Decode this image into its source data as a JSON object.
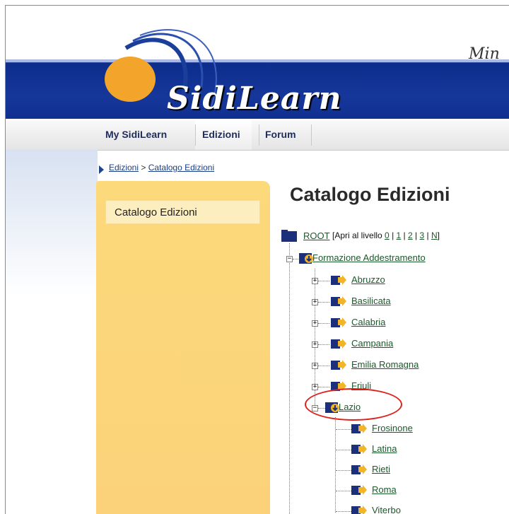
{
  "header": {
    "logo_text": "SidiLearn",
    "ministry_text": "Min"
  },
  "nav": {
    "items": [
      "My SidiLearn",
      "Edizioni",
      "Forum"
    ]
  },
  "breadcrumb": {
    "items": [
      "Edizioni",
      "Catalogo Edizioni"
    ],
    "separator": ">"
  },
  "sidebar": {
    "items": [
      "Catalogo Edizioni"
    ]
  },
  "main": {
    "title": "Catalogo Edizioni",
    "tree": {
      "root_label": "ROOT",
      "open_level_prefix": "[Apri al livello",
      "levels": [
        "0",
        "1",
        "2",
        "3",
        "N"
      ],
      "level_suffix": "]",
      "group_label": "Formazione Addestramento",
      "regions": [
        "Abruzzo",
        "Basilicata",
        "Calabria",
        "Campania",
        "Emilia Romagna",
        "Friuli",
        "Lazio"
      ],
      "lazio_children": [
        "Frosinone",
        "Latina",
        "Rieti",
        "Roma",
        "Viterbo"
      ]
    }
  },
  "colors": {
    "banner_blue": "#16379a",
    "sidebar_yellow": "#fbd27a",
    "link_green": "#1a5a2a",
    "highlight_red": "#e0201a"
  }
}
